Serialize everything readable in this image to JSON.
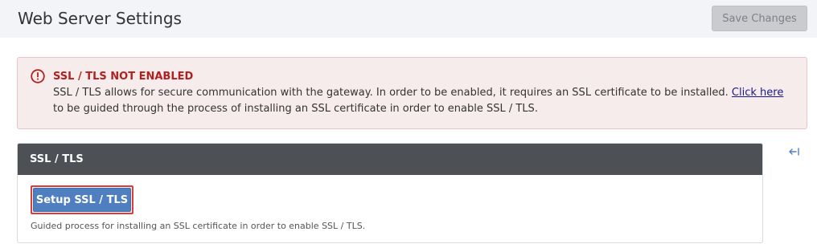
{
  "header": {
    "title": "Web Server Settings",
    "save_label": "Save Changes"
  },
  "alert": {
    "icon": "exclamation-circle-icon",
    "title": "SSL / TLS NOT ENABLED",
    "body_before": "SSL / TLS allows for secure communication with the gateway. In order to be enabled, it requires an SSL certificate to be installed. ",
    "link_text": "Click here",
    "body_after": " to be guided through the process of installing an SSL certificate in order to enable SSL / TLS."
  },
  "ssl_card": {
    "title": "SSL / TLS",
    "setup_button_label": "Setup SSL / TLS",
    "help_text": "Guided process for installing an SSL certificate in order to enable SSL / TLS."
  },
  "sidebar_toggle": {
    "icon": "collapse-arrow-icon"
  },
  "colors": {
    "alert_title": "#b32020",
    "alert_bg": "#f7ecec",
    "card_header_bg": "#4d5055",
    "primary_button": "#4f7fc0",
    "highlight_outline": "#e03a3a"
  }
}
